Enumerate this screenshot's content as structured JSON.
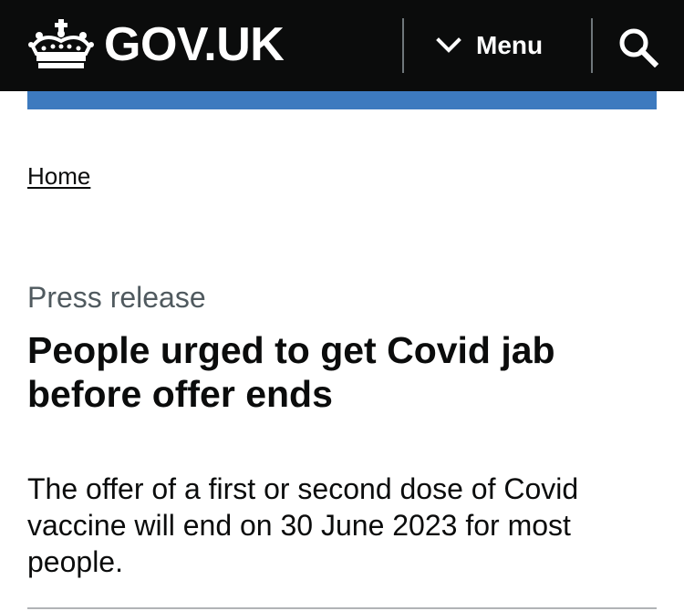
{
  "header": {
    "logo_text": "GOV.UK",
    "menu_label": "Menu",
    "menu_icon": "chevron-down-icon",
    "search_icon": "search-icon",
    "background_color": "#0b0c0c",
    "accent_bar_color": "#3d7abf"
  },
  "breadcrumb": {
    "items": [
      {
        "label": "Home"
      }
    ]
  },
  "article": {
    "type_label": "Press release",
    "title": "People urged to get Covid jab before offer ends",
    "summary": "The offer of a first or second dose of Covid vaccine will end on 30 June 2023 for most people."
  }
}
